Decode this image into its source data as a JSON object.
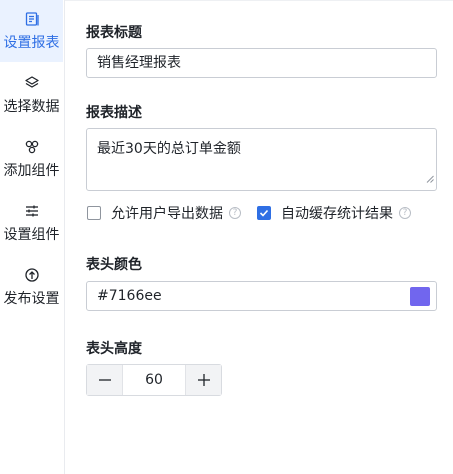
{
  "sidebar": {
    "items": [
      {
        "label": "设置报表",
        "icon": "report-settings-icon",
        "active": true
      },
      {
        "label": "选择数据",
        "icon": "layers-icon",
        "active": false
      },
      {
        "label": "添加组件",
        "icon": "components-icon",
        "active": false
      },
      {
        "label": "设置组件",
        "icon": "sliders-icon",
        "active": false
      },
      {
        "label": "发布设置",
        "icon": "publish-icon",
        "active": false
      }
    ]
  },
  "form": {
    "title_label": "报表标题",
    "title_value": "销售经理报表",
    "desc_label": "报表描述",
    "desc_value": "最近30天的总订单金额",
    "allow_export_label": "允许用户导出数据",
    "allow_export_checked": false,
    "auto_cache_label": "自动缓存统计结果",
    "auto_cache_checked": true,
    "help_glyph": "?",
    "header_color_label": "表头颜色",
    "header_color_value": "#7166ee",
    "header_height_label": "表头高度",
    "header_height_value": "60"
  },
  "colors": {
    "accent": "#2f6fe4",
    "active_bg": "#eaf2ff",
    "swatch": "#7166ee"
  }
}
